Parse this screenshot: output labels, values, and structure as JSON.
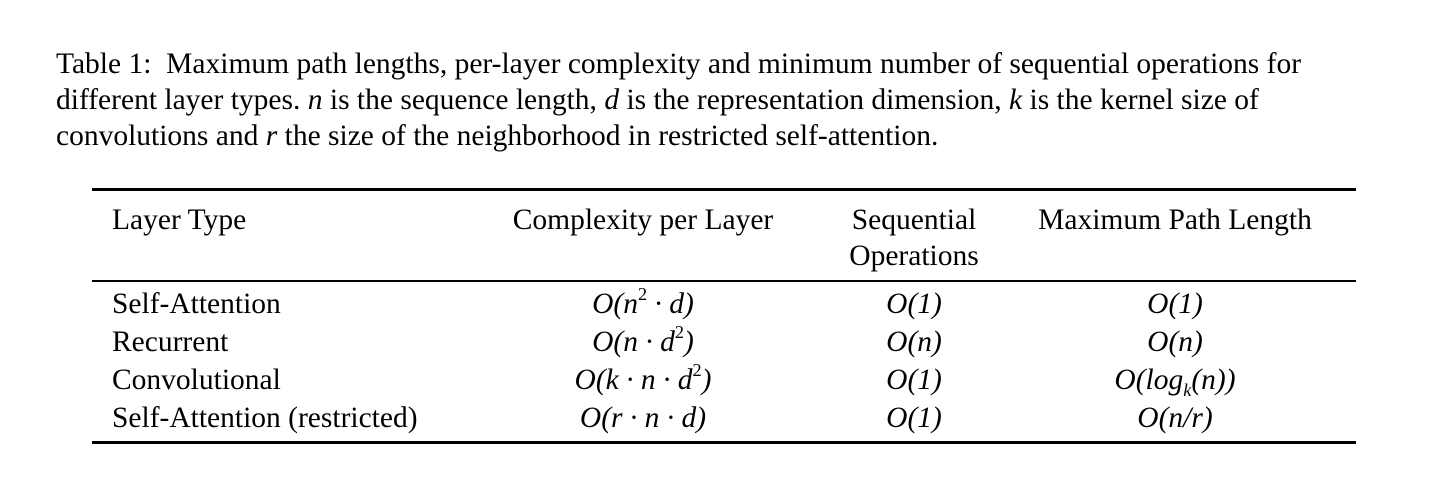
{
  "caption": {
    "label": "Table 1:",
    "text_1": "Maximum path lengths, per-layer complexity and minimum number of sequential operations for different layer types.",
    "var_n": "n",
    "text_2": "is the sequence length,",
    "var_d": "d",
    "text_3": "is the representation dimension,",
    "var_k": "k",
    "text_4": "is the kernel size of convolutions and",
    "var_r": "r",
    "text_5": "the size of the neighborhood in restricted self-attention."
  },
  "table": {
    "headers": {
      "layer_type": "Layer Type",
      "complexity": "Complexity per Layer",
      "sequential_line1": "Sequential",
      "sequential_line2": "Operations",
      "max_path": "Maximum Path Length"
    },
    "rows": [
      {
        "layer": "Self-Attention",
        "complexity": {
          "pre": "O(n",
          "sup": "2",
          "post": " · d)"
        },
        "sequential": "O(1)",
        "max_path": {
          "pre": "O(1)",
          "sub": "",
          "post": ""
        }
      },
      {
        "layer": "Recurrent",
        "complexity": {
          "pre": "O(n · d",
          "sup": "2",
          "post": ")"
        },
        "sequential": "O(n)",
        "max_path": {
          "pre": "O(n)",
          "sub": "",
          "post": ""
        }
      },
      {
        "layer": "Convolutional",
        "complexity": {
          "pre": "O(k · n · d",
          "sup": "2",
          "post": ")"
        },
        "sequential": "O(1)",
        "max_path": {
          "pre": "O(log",
          "sub": "k",
          "post": "(n))"
        }
      },
      {
        "layer": "Self-Attention (restricted)",
        "complexity": {
          "pre": "O(r · n · d)",
          "sup": "",
          "post": ""
        },
        "sequential": "O(1)",
        "max_path": {
          "pre": "O(n/r)",
          "sub": "",
          "post": ""
        }
      }
    ]
  }
}
